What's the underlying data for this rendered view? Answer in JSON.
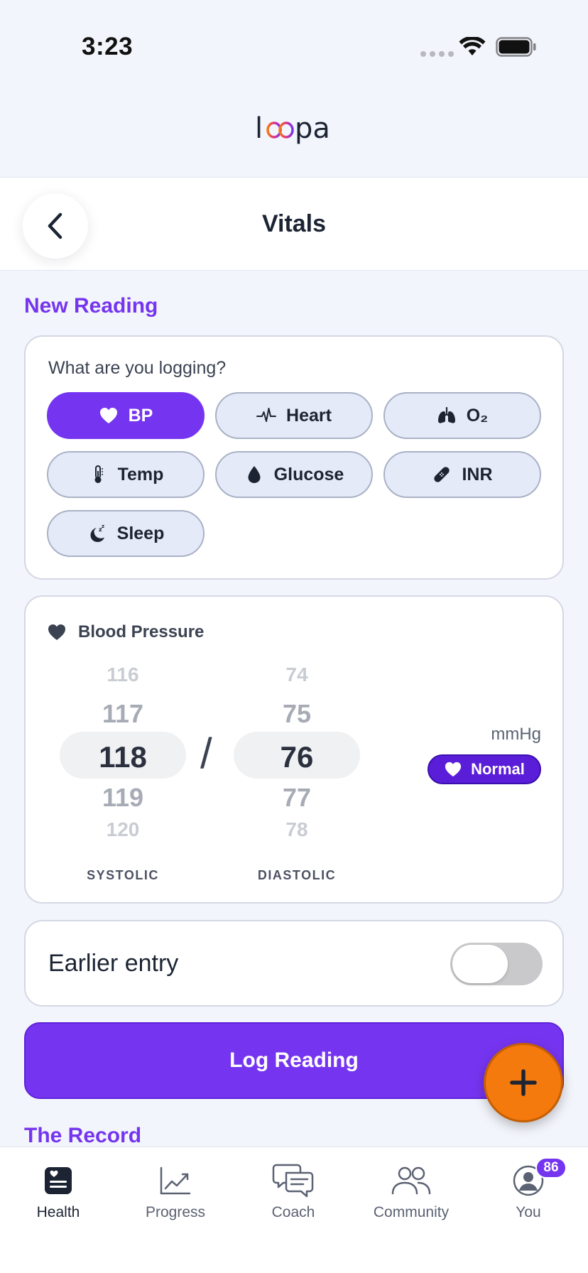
{
  "status_bar": {
    "time": "3:23"
  },
  "app": {
    "logo_text": "loopa",
    "brand_color": "#7535f0",
    "accent_color": "#f47a0d"
  },
  "header": {
    "title": "Vitals"
  },
  "new_reading": {
    "section_title": "New Reading",
    "question": "What are you logging?",
    "types": [
      {
        "label": "BP",
        "icon": "heart-icon",
        "selected": true
      },
      {
        "label": "Heart",
        "icon": "pulse-icon",
        "selected": false
      },
      {
        "label": "O₂",
        "icon": "lungs-icon",
        "selected": false
      },
      {
        "label": "Temp",
        "icon": "thermometer-icon",
        "selected": false
      },
      {
        "label": "Glucose",
        "icon": "drop-icon",
        "selected": false
      },
      {
        "label": "INR",
        "icon": "bandage-icon",
        "selected": false
      },
      {
        "label": "Sleep",
        "icon": "moon-icon",
        "selected": false
      }
    ]
  },
  "blood_pressure": {
    "title": "Blood Pressure",
    "systolic": {
      "label": "SYSTOLIC",
      "values": [
        "116",
        "117",
        "118",
        "119",
        "120"
      ],
      "selected": "118"
    },
    "diastolic": {
      "label": "DIASTOLIC",
      "values": [
        "74",
        "75",
        "76",
        "77",
        "78"
      ],
      "selected": "76"
    },
    "separator": "/",
    "unit": "mmHg",
    "status": "Normal"
  },
  "earlier_entry": {
    "label": "Earlier entry",
    "enabled": false
  },
  "log_button": {
    "label": "Log Reading"
  },
  "record": {
    "section_title": "The Record"
  },
  "tabs": [
    {
      "label": "Health",
      "icon": "health-icon",
      "active": true
    },
    {
      "label": "Progress",
      "icon": "chart-icon",
      "active": false
    },
    {
      "label": "Coach",
      "icon": "chat-icon",
      "active": false
    },
    {
      "label": "Community",
      "icon": "people-icon",
      "active": false
    },
    {
      "label": "You",
      "icon": "profile-icon",
      "active": false,
      "badge": "86"
    }
  ]
}
